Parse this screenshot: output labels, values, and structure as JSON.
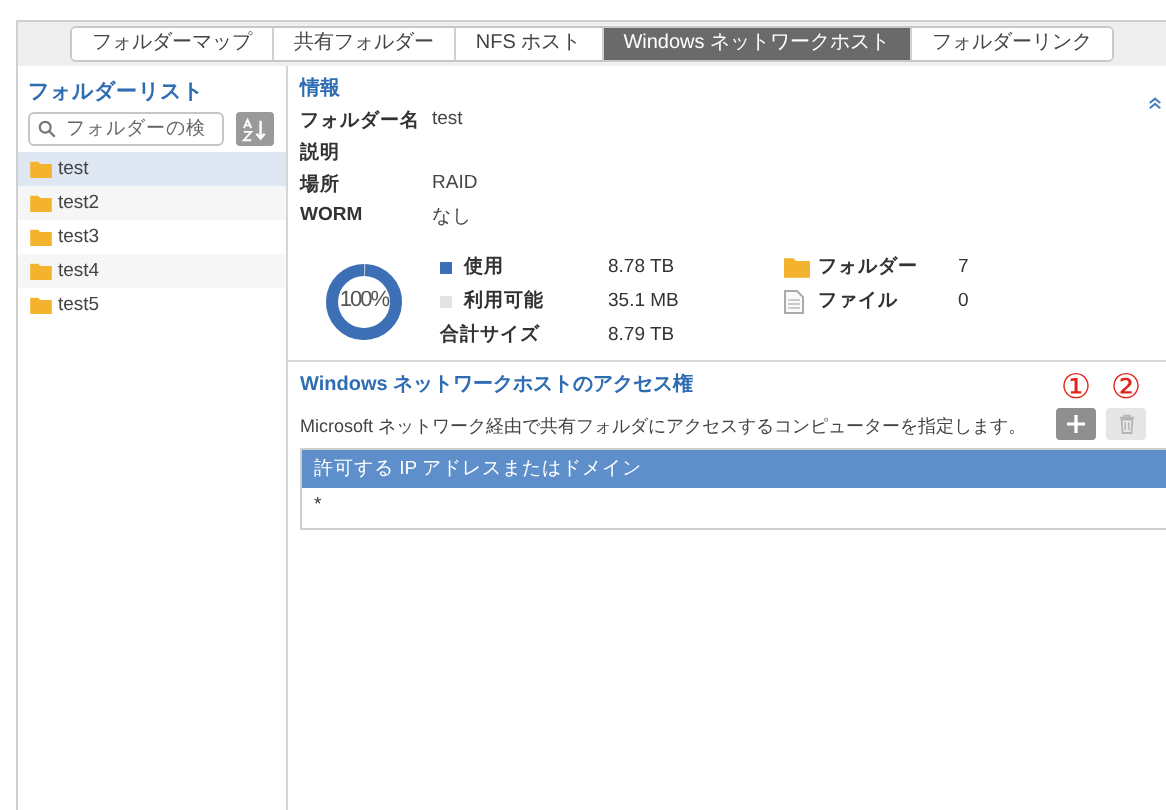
{
  "tabs": [
    {
      "label": "フォルダーマップ",
      "selected": false
    },
    {
      "label": "共有フォルダー",
      "selected": false
    },
    {
      "label": "NFS ホスト",
      "selected": false
    },
    {
      "label": "Windows ネットワークホスト",
      "selected": true
    },
    {
      "label": "フォルダーリンク",
      "selected": false
    }
  ],
  "sidebar": {
    "title": "フォルダーリスト",
    "search": {
      "placeholder": "フォルダーの検"
    },
    "items": [
      {
        "label": "test",
        "selected": true
      },
      {
        "label": "test2",
        "selected": false
      },
      {
        "label": "test3",
        "selected": false
      },
      {
        "label": "test4",
        "selected": false
      },
      {
        "label": "test5",
        "selected": false
      }
    ]
  },
  "info": {
    "title": "情報",
    "rows": [
      {
        "label": "フォルダー名",
        "value": "test"
      },
      {
        "label": "説明",
        "value": ""
      },
      {
        "label": "場所",
        "value": "RAID"
      },
      {
        "label": "WORM",
        "value": "なし"
      }
    ],
    "usage": {
      "level": 1,
      "center_label": "100%",
      "legend": [
        {
          "label": "使用",
          "value": "8.78 TB",
          "color": "#3d6fb6"
        },
        {
          "label": "利用可能",
          "value": "35.1 MB",
          "color": "#e3e3e3"
        }
      ],
      "total": {
        "label": "合計サイズ",
        "value": "8.79 TB"
      }
    },
    "counts": [
      {
        "kind": "folder",
        "label": "フォルダー",
        "value": "7"
      },
      {
        "kind": "file",
        "label": "ファイル",
        "value": "0"
      }
    ]
  },
  "access": {
    "title": "Windows ネットワークホストのアクセス権",
    "description": "Microsoft ネットワーク経由で共有フォルダにアクセスするコンピューターを指定します。",
    "buttons": [
      {
        "kind": "add",
        "callout": "①",
        "disabled": false
      },
      {
        "kind": "delete",
        "callout": "②",
        "disabled": true
      }
    ],
    "table": {
      "columns": [
        "許可する IP アドレスまたはドメイン"
      ],
      "rows": [
        [
          "*"
        ]
      ]
    }
  }
}
